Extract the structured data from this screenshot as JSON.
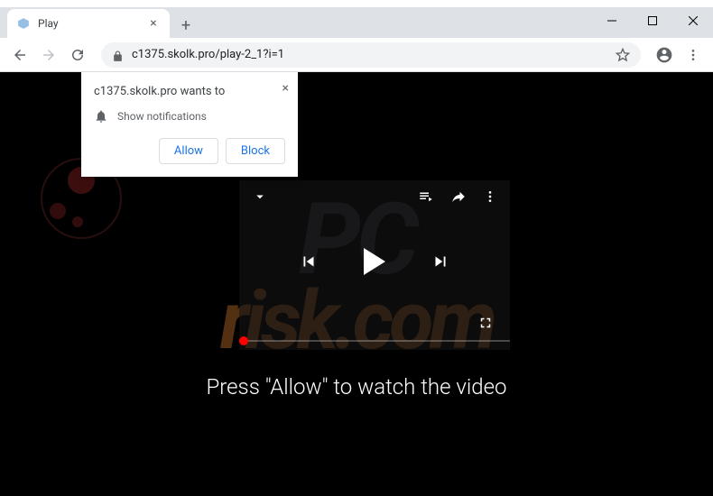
{
  "window": {
    "tab_title": "Play",
    "url": "c1375.skolk.pro/play-2_1?i=1"
  },
  "notification": {
    "title": "c1375.skolk.pro wants to",
    "permission_text": "Show notifications",
    "allow_label": "Allow",
    "block_label": "Block"
  },
  "page": {
    "message": "Press \"Allow\" to watch the video"
  },
  "watermark": {
    "line1": "PC",
    "line2": "risk.com"
  }
}
